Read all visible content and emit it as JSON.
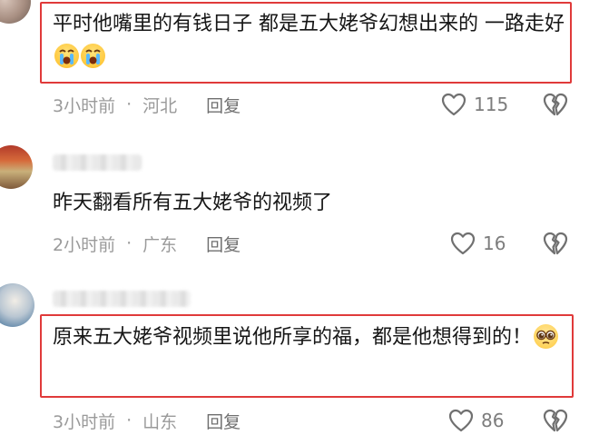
{
  "comments": [
    {
      "text": "平时他嘴里的有钱日子 都是五大姥爷幻想出来的 一路走好",
      "emojis": [
        "loudly-crying-face",
        "loudly-crying-face"
      ],
      "time": "3小时前",
      "location": "河北",
      "reply_label": "回复",
      "likes": "115",
      "highlighted": true
    },
    {
      "text": "昨天翻看所有五大姥爷的视频了",
      "emojis": [],
      "time": "2小时前",
      "location": "广东",
      "reply_label": "回复",
      "likes": "16",
      "highlighted": false
    },
    {
      "text": "原来五大姥爷视频里说他所享的福，都是他想得到的！",
      "emojis": [
        "pleading-face"
      ],
      "time": "3小时前",
      "location": "山东",
      "reply_label": "回复",
      "likes": "86",
      "highlighted": true
    }
  ],
  "colors": {
    "highlight_border": "#e03a3a",
    "meta_text": "#9a9a9a",
    "comment_text": "#161616"
  }
}
